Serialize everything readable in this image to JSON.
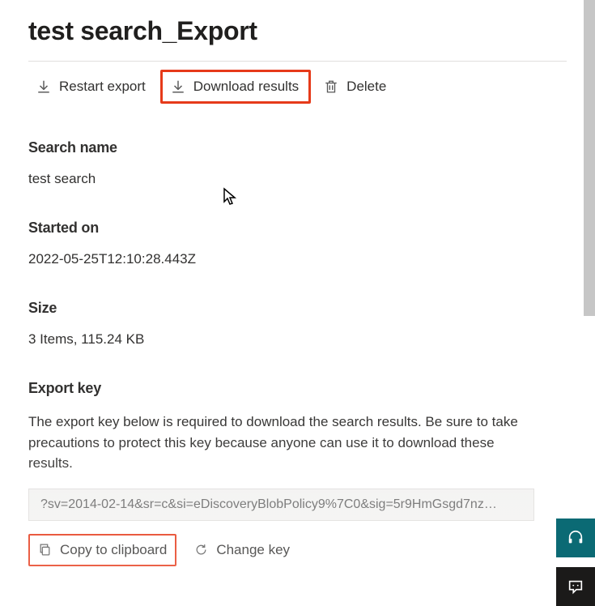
{
  "header": {
    "title": "test search_Export"
  },
  "toolbar": {
    "restart_label": "Restart export",
    "download_label": "Download results",
    "delete_label": "Delete"
  },
  "search": {
    "label": "Search name",
    "value": "test search"
  },
  "started": {
    "label": "Started on",
    "value": "2022-05-25T12:10:28.443Z"
  },
  "size": {
    "label": "Size",
    "value": "3 Items, 115.24 KB"
  },
  "export_key": {
    "label": "Export key",
    "description": "The export key below is required to download the search results. Be sure to take precautions to protect this key because anyone can use it to download these results.",
    "value": "?sv=2014-02-14&sr=c&si=eDiscoveryBlobPolicy9%7C0&sig=5r9HmGsgd7nz…",
    "copy_label": "Copy to clipboard",
    "change_label": "Change key"
  }
}
